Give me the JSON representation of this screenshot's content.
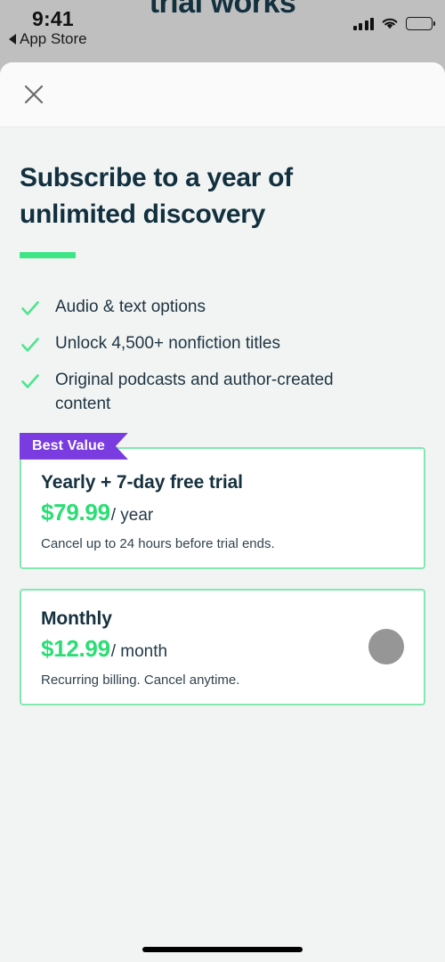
{
  "status_bar": {
    "time": "9:41",
    "back_label": "App Store",
    "back_icon": "triangle-left-icon",
    "signal_icon": "cellular-signal-icon",
    "wifi_icon": "wifi-icon",
    "battery_icon": "battery-full-icon"
  },
  "background_page": {
    "headline_fragment": "trial works"
  },
  "sheet": {
    "close_icon": "close-x-icon",
    "headline": "Subscribe to a year of unlimited discovery",
    "features": [
      {
        "icon": "check-icon",
        "label": "Audio & text options"
      },
      {
        "icon": "check-icon",
        "label": "Unlock 4,500+ nonfiction titles"
      },
      {
        "icon": "check-icon",
        "label": "Original podcasts and author-created content"
      }
    ],
    "plans": [
      {
        "badge": "Best Value",
        "title": "Yearly + 7-day free trial",
        "price": "$79.99",
        "period": "/ year",
        "note": "Cancel up to 24 hours before trial ends."
      },
      {
        "badge": "",
        "title": "Monthly",
        "price": "$12.99",
        "period": "/ month",
        "note": "Recurring billing. Cancel anytime."
      }
    ]
  },
  "colors": {
    "accent_green": "#3ee585",
    "price_green": "#2ade74",
    "card_border_green": "#81e9af",
    "badge_purple": "#7a3ce0",
    "headline_navy": "#12303f",
    "page_bg": "#f1f4f3",
    "cursor_gray": "#969696"
  },
  "home_indicator": "home-indicator"
}
